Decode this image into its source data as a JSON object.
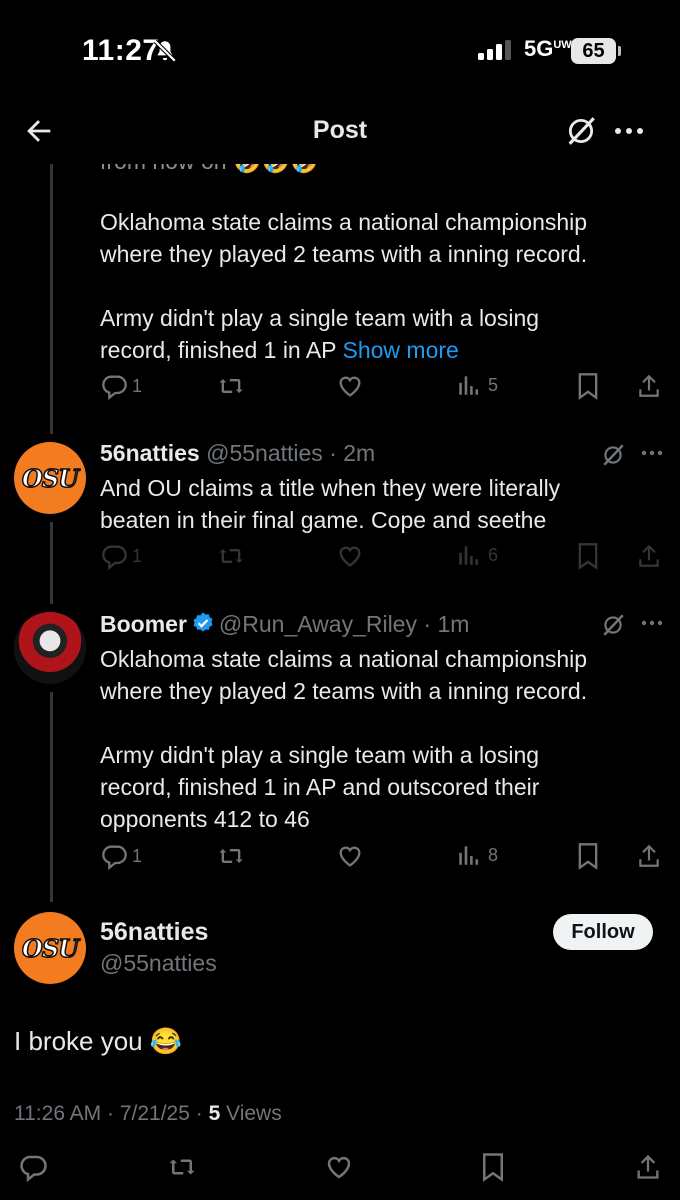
{
  "status_bar": {
    "time": "11:27",
    "network": "5G",
    "network_sup": "UW",
    "battery": "65"
  },
  "header": {
    "title": "Post"
  },
  "parent_tweet": {
    "partial_top": "from now on 🤣🤣🤣",
    "text": "Oklahoma state claims a national championship\nwhere they played 2 teams with a inning record.\n\nArmy didn't play a single team with a losing\nrecord, finished 1 in AP ",
    "show_more": "Show more",
    "replies": "1",
    "views": "5"
  },
  "reply1": {
    "name": "56natties",
    "handle": "@55natties",
    "time": "2m",
    "text": "And OU claims a title when they were literally\nbeaten in their final game. Cope and seethe",
    "replies": "1",
    "views": "6"
  },
  "reply2": {
    "name": "Boomer",
    "handle": "@Run_Away_Riley",
    "time": "1m",
    "text": "Oklahoma state claims a national championship\nwhere they played 2 teams with a inning record.\n\nArmy didn't play a single team with a losing\nrecord, finished 1 in AP and outscored their\nopponents 412 to 46",
    "replies": "1",
    "views": "8"
  },
  "main_tweet": {
    "name": "56natties",
    "handle": "@55natties",
    "follow_label": "Follow",
    "text": "I broke you 😂",
    "timestamp": "11:26 AM · 7/21/25 · ",
    "views_count": "5",
    "views_label": " Views"
  },
  "avatar_logo": "OSU",
  "colors": {
    "accent": "#1d9bf0",
    "osu_orange": "#f47c20",
    "secondary_text": "#71767b"
  },
  "icons": [
    "back-arrow-icon",
    "grok-icon",
    "more-icon",
    "reply-icon",
    "repost-icon",
    "like-icon",
    "views-icon",
    "bookmark-icon",
    "share-icon",
    "verified-icon",
    "bell-off-icon"
  ]
}
